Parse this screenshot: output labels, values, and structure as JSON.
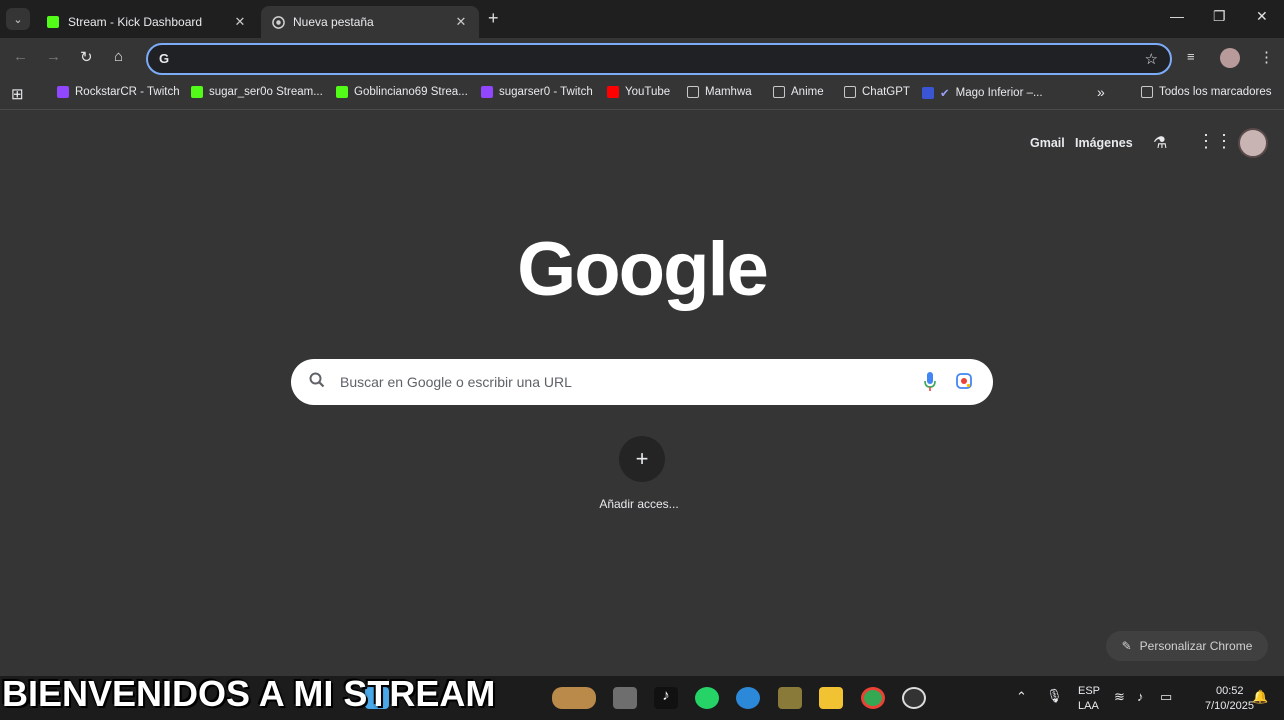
{
  "tabs": [
    {
      "title": "Stream - Kick Dashboard",
      "icon": "kick-icon"
    },
    {
      "title": "Nueva pestaña",
      "icon": "chrome-icon"
    }
  ],
  "omnibox": {
    "value": "",
    "placeholder": ""
  },
  "bookmarks": [
    {
      "label": "RockstarCR - Twitch",
      "icon": "twitch-icon"
    },
    {
      "label": "sugar_ser0o Stream...",
      "icon": "kick-icon"
    },
    {
      "label": "Goblinciano69 Strea...",
      "icon": "kick-icon"
    },
    {
      "label": "sugarser0 - Twitch",
      "icon": "twitch-icon"
    },
    {
      "label": "YouTube",
      "icon": "youtube-icon"
    },
    {
      "label": "Mamhwa",
      "icon": "folder-icon"
    },
    {
      "label": "Anime",
      "icon": "folder-icon"
    },
    {
      "label": "ChatGPT",
      "icon": "chatgpt-icon"
    },
    {
      "label": "Mago Inferior –...",
      "icon": "mago-icon"
    }
  ],
  "all_bookmarks": "Todos los marcadores",
  "gbar": {
    "gmail": "Gmail",
    "images": "Imágenes"
  },
  "logo_text": "Google",
  "search": {
    "placeholder": "Buscar en Google o escribir una URL"
  },
  "shortcut": {
    "label": "Añadir acces..."
  },
  "customize": {
    "label": "Personalizar Chrome"
  },
  "overlay_text": "BIENVENIDOS A MI STREAM",
  "tray": {
    "lang_top": "ESP",
    "lang_bottom": "LAA",
    "time": "00:52",
    "date": "7/10/2025"
  },
  "colors": {
    "accent": "#7cacf8",
    "background": "#353535",
    "tabstrip": "#1f1f1f",
    "taskbar": "#1c1c1c"
  }
}
